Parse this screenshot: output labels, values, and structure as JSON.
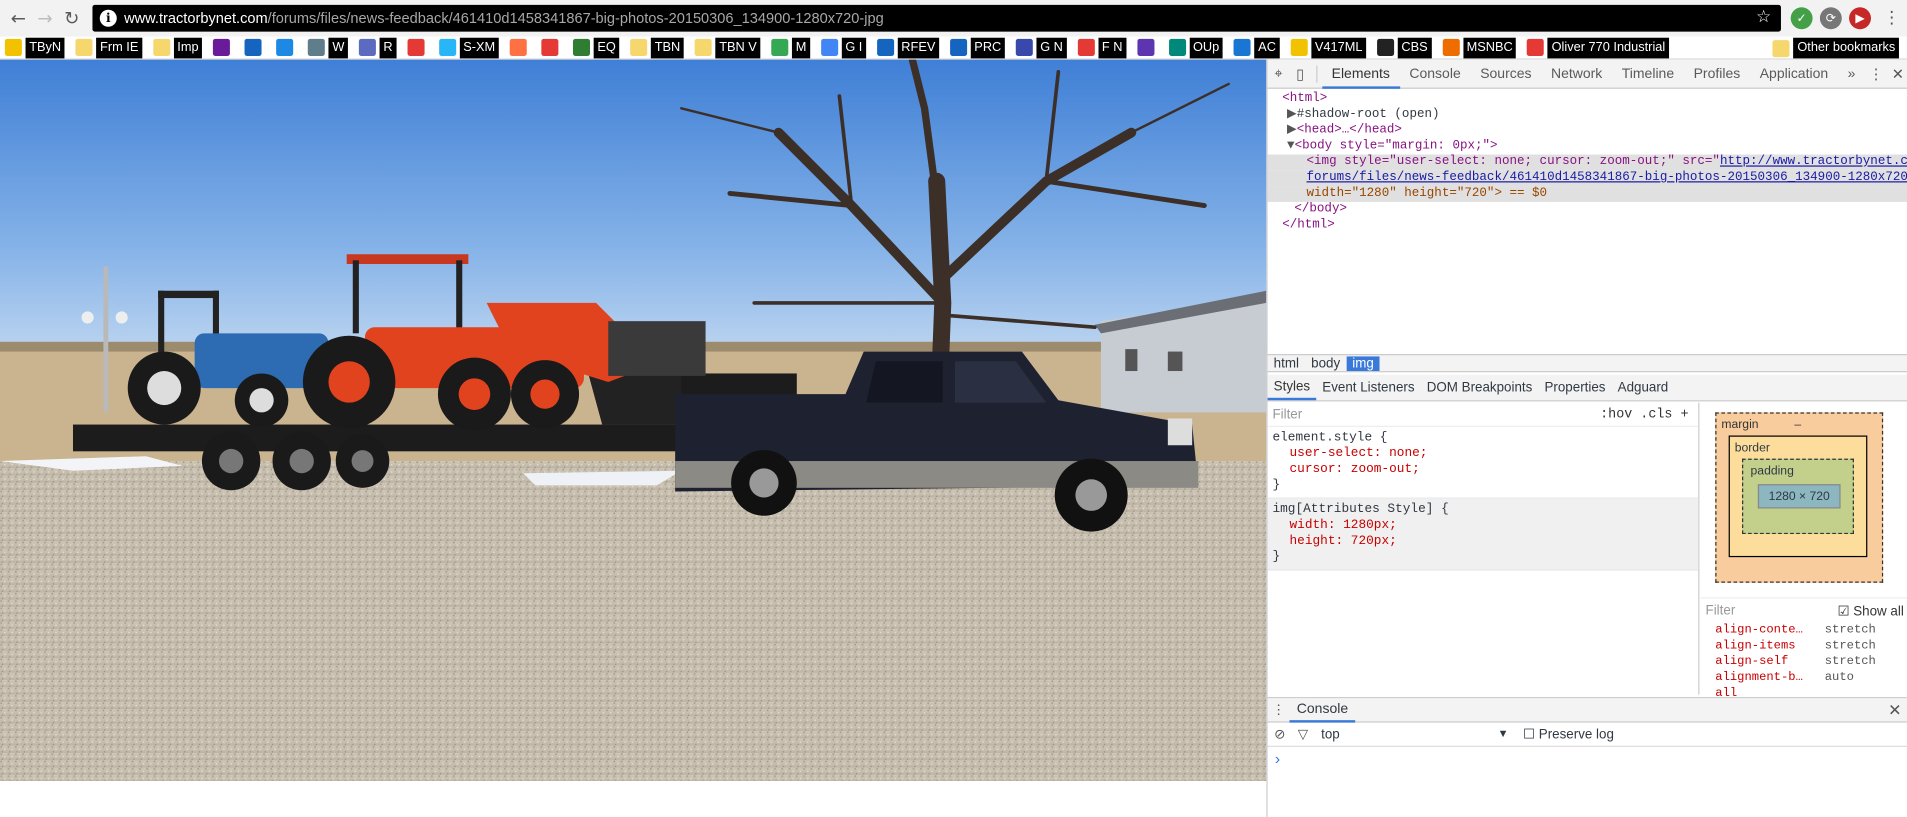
{
  "browser": {
    "url_host": "www.tractorbynet.com",
    "url_path": "/forums/files/news-feedback/461410d1458341867-big-photos-20150306_134900-1280x720-jpg",
    "back_icon": "back-arrow-icon",
    "forward_icon": "forward-arrow-icon",
    "reload_icon": "reload-icon",
    "star_icon": "star-icon"
  },
  "bookmarks": [
    {
      "label": "TByN",
      "color": "#f2c200"
    },
    {
      "label": "Frm IE",
      "color": "#f5d76e"
    },
    {
      "label": "Imp",
      "color": "#f5d76e"
    },
    {
      "label": "",
      "color": "#6a1b9a"
    },
    {
      "label": "",
      "color": "#1565c0"
    },
    {
      "label": "",
      "color": "#1e88e5"
    },
    {
      "label": "W",
      "color": "#607d8b"
    },
    {
      "label": "R",
      "color": "#5c6bc0"
    },
    {
      "label": "",
      "color": "#e53935"
    },
    {
      "label": "S-XM",
      "color": "#29b6f6"
    },
    {
      "label": "",
      "color": "#ff7043"
    },
    {
      "label": "",
      "color": "#e53935"
    },
    {
      "label": "EQ",
      "color": "#2e7d32"
    },
    {
      "label": "TBN",
      "color": "#f5d76e"
    },
    {
      "label": "TBN V",
      "color": "#f5d76e"
    },
    {
      "label": "M",
      "color": "#34a853"
    },
    {
      "label": "G I",
      "color": "#4285f4"
    },
    {
      "label": "RFEV",
      "color": "#1565c0"
    },
    {
      "label": "PRC",
      "color": "#1565c0"
    },
    {
      "label": "G N",
      "color": "#3949ab"
    },
    {
      "label": "F N",
      "color": "#e53935"
    },
    {
      "label": "",
      "color": "#5e35b1"
    },
    {
      "label": "OUp",
      "color": "#00897b"
    },
    {
      "label": "AC",
      "color": "#1976d2"
    },
    {
      "label": "V417ML",
      "color": "#f2c200"
    },
    {
      "label": "CBS",
      "color": "#222222"
    },
    {
      "label": "MSNBC",
      "color": "#ef6c00"
    },
    {
      "label": "Oliver 770 Industrial",
      "color": "#e53935"
    }
  ],
  "other_bookmarks": "Other bookmarks",
  "devtools": {
    "tabs": [
      "Elements",
      "Console",
      "Sources",
      "Network",
      "Timeline",
      "Profiles",
      "Application"
    ],
    "more": "»",
    "code": {
      "html_open": "<html>",
      "shadow": "#shadow-root (open)",
      "head": "<head>…</head>",
      "body_open": "<body style=\"margin: 0px;\">",
      "img_1": "<img style=\"user-select: none; cursor: zoom-out;\" src=\"",
      "img_link_1": "http://www.tractorbynet.com/",
      "img_link_2": "forums/files/news-feedback/461410d1458341867-big-photos-20150306_134900-1280x720-jpg",
      "img_3": "width=\"1280\" height=\"720\"> == $0",
      "body_close": "</body>",
      "html_close": "</html>"
    },
    "breadcrumbs": [
      "html",
      "body",
      "img"
    ],
    "subtabs": [
      "Styles",
      "Event Listeners",
      "DOM Breakpoints",
      "Properties",
      "Adguard"
    ],
    "filter_placeholder": "Filter",
    "hov_cls": ":hov  .cls  +",
    "rules": {
      "r1_selector": "element.style {",
      "r1_p1": "user-select: none;",
      "r1_p2": "cursor: zoom-out;",
      "r1_close": "}",
      "r2_selector": "img[Attributes Style] {",
      "r2_p1": "width: 1280px;",
      "r2_p2": "height: 720px;",
      "r2_close": "}"
    },
    "box_model": {
      "margin": "margin",
      "border": "border",
      "padding": "padding",
      "content": "1280 × 720",
      "dash": "–"
    },
    "computed_filter": "Filter",
    "show_all": "Show all",
    "computed": [
      {
        "k": "align-conte…",
        "v": "stretch"
      },
      {
        "k": "align-items",
        "v": "stretch"
      },
      {
        "k": "align-self",
        "v": "stretch"
      },
      {
        "k": "alignment-b…",
        "v": "auto"
      },
      {
        "k": "all",
        "v": ""
      }
    ],
    "console_tab": "Console",
    "context": "top",
    "preserve_log": "Preserve log",
    "prompt": "›"
  }
}
